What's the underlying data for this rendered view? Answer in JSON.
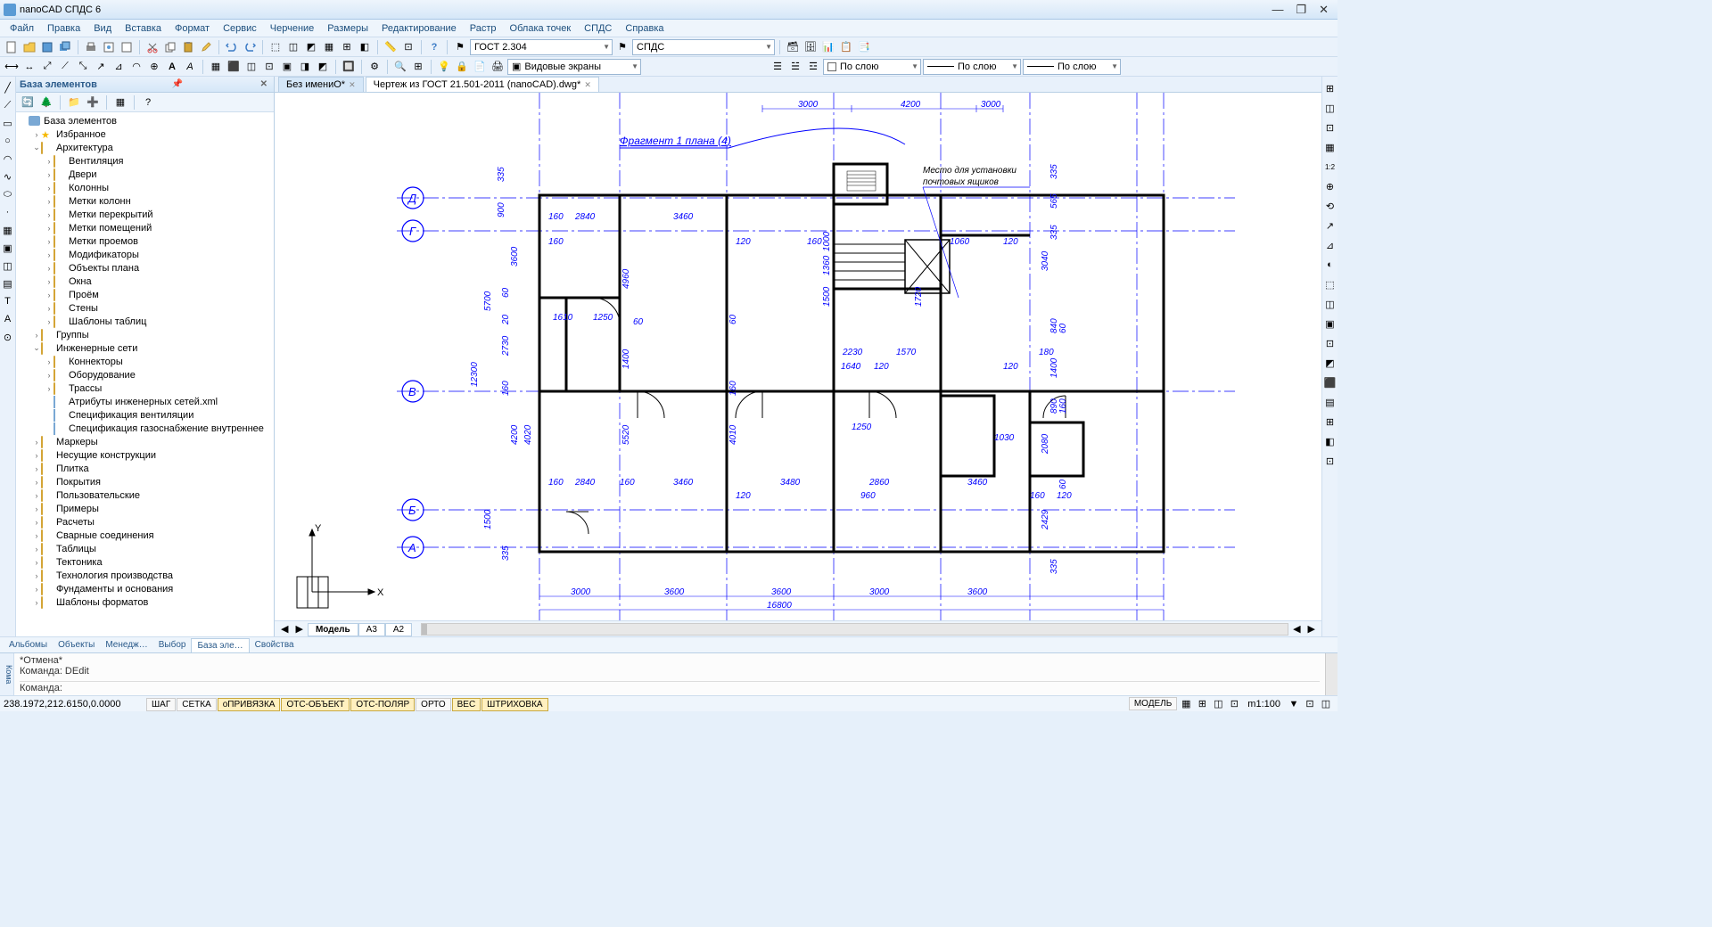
{
  "app": {
    "title": "nanoCAD СПДС 6"
  },
  "menu": [
    "Файл",
    "Правка",
    "Вид",
    "Вставка",
    "Формат",
    "Сервис",
    "Черчение",
    "Размеры",
    "Редактирование",
    "Растр",
    "Облака точек",
    "СПДС",
    "Справка"
  ],
  "combo1": "ГОСТ 2.304",
  "combo2": "СПДС",
  "combo3": "Видовые экраны",
  "layer_combos": {
    "a": "По слою",
    "b": "По слою",
    "c": "По слою"
  },
  "panel": {
    "title": "База элементов"
  },
  "tree": [
    {
      "d": 0,
      "t": "r",
      "i": "db",
      "l": "База элементов"
    },
    {
      "d": 1,
      "t": "c",
      "i": "star",
      "l": "Избранное"
    },
    {
      "d": 1,
      "t": "o",
      "i": "fo",
      "l": "Архитектура"
    },
    {
      "d": 2,
      "t": "c",
      "i": "f",
      "l": "Вентиляция"
    },
    {
      "d": 2,
      "t": "c",
      "i": "f",
      "l": "Двери"
    },
    {
      "d": 2,
      "t": "c",
      "i": "f",
      "l": "Колонны"
    },
    {
      "d": 2,
      "t": "c",
      "i": "f",
      "l": "Метки колонн"
    },
    {
      "d": 2,
      "t": "c",
      "i": "f",
      "l": "Метки перекрытий"
    },
    {
      "d": 2,
      "t": "c",
      "i": "f",
      "l": "Метки помещений"
    },
    {
      "d": 2,
      "t": "c",
      "i": "f",
      "l": "Метки проемов"
    },
    {
      "d": 2,
      "t": "c",
      "i": "f",
      "l": "Модификаторы"
    },
    {
      "d": 2,
      "t": "c",
      "i": "f",
      "l": "Объекты плана"
    },
    {
      "d": 2,
      "t": "c",
      "i": "f",
      "l": "Окна"
    },
    {
      "d": 2,
      "t": "c",
      "i": "f",
      "l": "Проём"
    },
    {
      "d": 2,
      "t": "c",
      "i": "f",
      "l": "Стены"
    },
    {
      "d": 2,
      "t": "c",
      "i": "f",
      "l": "Шаблоны таблиц"
    },
    {
      "d": 1,
      "t": "c",
      "i": "f",
      "l": "Группы"
    },
    {
      "d": 1,
      "t": "o",
      "i": "fo",
      "l": "Инженерные сети"
    },
    {
      "d": 2,
      "t": "c",
      "i": "f",
      "l": "Коннекторы"
    },
    {
      "d": 2,
      "t": "c",
      "i": "f",
      "l": "Оборудование"
    },
    {
      "d": 2,
      "t": "c",
      "i": "f",
      "l": "Трассы"
    },
    {
      "d": 2,
      "t": "n",
      "i": "d",
      "l": "Атрибуты инженерных сетей.xml"
    },
    {
      "d": 2,
      "t": "n",
      "i": "d",
      "l": "Спецификация вентиляции"
    },
    {
      "d": 2,
      "t": "n",
      "i": "d",
      "l": "Спецификация газоснабжение внутреннее"
    },
    {
      "d": 1,
      "t": "c",
      "i": "f",
      "l": "Маркеры"
    },
    {
      "d": 1,
      "t": "c",
      "i": "f",
      "l": "Несущие конструкции"
    },
    {
      "d": 1,
      "t": "c",
      "i": "f",
      "l": "Плитка"
    },
    {
      "d": 1,
      "t": "c",
      "i": "f",
      "l": "Покрытия"
    },
    {
      "d": 1,
      "t": "c",
      "i": "f",
      "l": "Пользовательские"
    },
    {
      "d": 1,
      "t": "c",
      "i": "f",
      "l": "Примеры"
    },
    {
      "d": 1,
      "t": "c",
      "i": "f",
      "l": "Расчеты"
    },
    {
      "d": 1,
      "t": "c",
      "i": "f",
      "l": "Сварные соединения"
    },
    {
      "d": 1,
      "t": "c",
      "i": "f",
      "l": "Таблицы"
    },
    {
      "d": 1,
      "t": "c",
      "i": "f",
      "l": "Тектоника"
    },
    {
      "d": 1,
      "t": "c",
      "i": "f",
      "l": "Технология производства"
    },
    {
      "d": 1,
      "t": "c",
      "i": "f",
      "l": "Фундаменты и основания"
    },
    {
      "d": 1,
      "t": "c",
      "i": "f",
      "l": "Шаблоны форматов"
    }
  ],
  "doctabs": [
    {
      "l": "Без имениO*",
      "active": false
    },
    {
      "l": "Чертеж из ГОСТ 21.501-2011 (nanoCAD).dwg*",
      "active": true
    }
  ],
  "modeltabs": [
    "Модель",
    "A3",
    "A2"
  ],
  "bottomtabs": [
    "Альбомы",
    "Объекты",
    "Менедж…",
    "Выбор",
    "База эле…",
    "Свойства"
  ],
  "bottomtab_active": 4,
  "cmd": {
    "label": "Кома",
    "line1": "*Отмена*",
    "line2": "Команда: DEdit",
    "prompt": "Команда:"
  },
  "status": {
    "coords": "238.1972,212.6150,0.0000",
    "btns": [
      {
        "l": "ШАГ",
        "on": false
      },
      {
        "l": "СЕТКА",
        "on": false
      },
      {
        "l": "оПРИВЯЗКА",
        "on": true
      },
      {
        "l": "ОТС-ОБЪЕКТ",
        "on": true
      },
      {
        "l": "ОТС-ПОЛЯР",
        "on": true
      },
      {
        "l": "ОРТО",
        "on": false
      },
      {
        "l": "ВЕС",
        "on": true
      },
      {
        "l": "ШТРИХОВКА",
        "on": true
      }
    ],
    "model": "МОДЕЛЬ",
    "scale": "m1:100"
  },
  "drawing": {
    "fragment_label": "Фрагмент 1 плана (4)",
    "note1": "Место для установки",
    "note2": "почтовых ящиков",
    "grid_letters": [
      "Д",
      "Г",
      "В",
      "Б",
      "А"
    ],
    "top_dims": [
      "3000",
      "4200",
      "3000"
    ],
    "bottom_dims": [
      "3000",
      "3600",
      "3600",
      "3000",
      "3600"
    ],
    "total_dim": "16800",
    "inner_dims": {
      "h": [
        "160",
        "2840",
        "160",
        "3460",
        "120",
        "160",
        "1060",
        "120",
        "160",
        "60",
        "1250",
        "1640",
        "120",
        "2230",
        "1570",
        "180",
        "120",
        "160",
        "1610",
        "160",
        "2840",
        "160",
        "3460",
        "3480",
        "2860",
        "3460",
        "120",
        "960",
        "120",
        "160",
        "120"
      ],
      "v": [
        "335",
        "900",
        "3600",
        "5700",
        "2730",
        "60",
        "20",
        "160",
        "4200",
        "12300",
        "1500",
        "335",
        "4960",
        "1400",
        "60",
        "5520",
        "160",
        "4010",
        "565",
        "335",
        "3040",
        "840",
        "60",
        "1400",
        "890",
        "160",
        "2080",
        "2429",
        "60",
        "335",
        "1000",
        "1360",
        "1500",
        "1720",
        "1250",
        "1030",
        "160"
      ]
    }
  }
}
